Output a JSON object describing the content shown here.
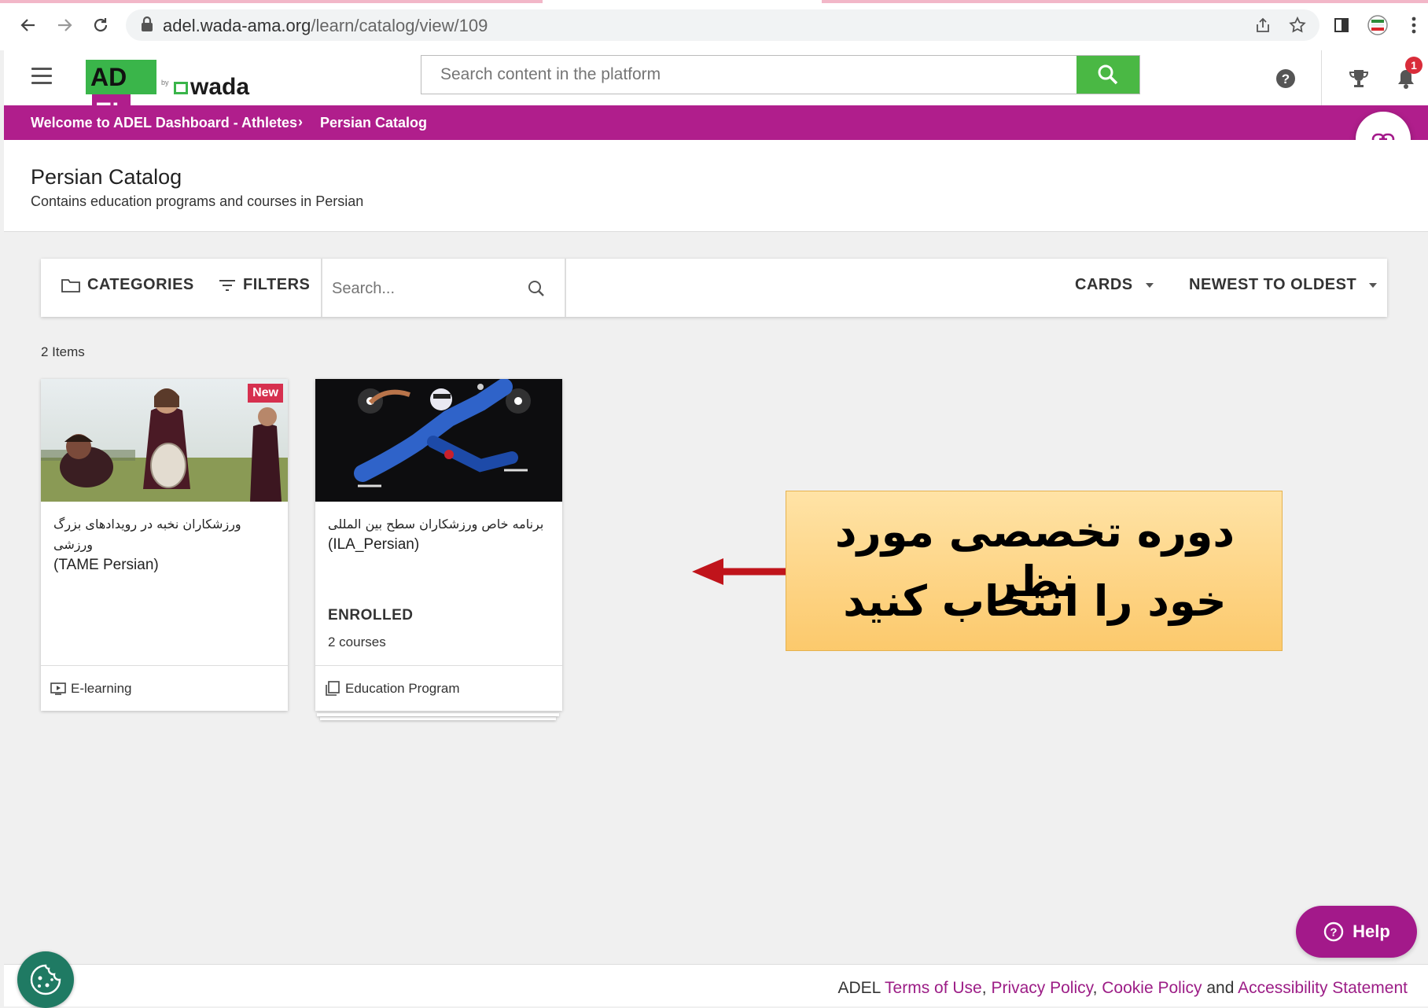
{
  "browser": {
    "url_host": "adel.wada-ama.org",
    "url_path": "/learn/catalog/view/109"
  },
  "header": {
    "logo_adel_left": "AD",
    "logo_adel_right": "EL",
    "logo_by": "by",
    "logo_wada": "wada",
    "search_placeholder": "Search content in the platform",
    "notification_count": "1"
  },
  "breadcrumb": {
    "items": [
      "Welcome to ADEL Dashboard - Athletes",
      "Persian Catalog"
    ],
    "separator": "›"
  },
  "page": {
    "title": "Persian Catalog",
    "subtitle": "Contains education programs and courses in Persian"
  },
  "toolbar": {
    "categories_label": "CATEGORIES",
    "filters_label": "FILTERS",
    "search_placeholder": "Search...",
    "view_label": "CARDS",
    "sort_label": "NEWEST TO OLDEST"
  },
  "items_count": "2 Items",
  "cards": [
    {
      "badge": "New",
      "title_fa": "ورزشکاران نخبه در رویدادهای بزرگ ورزشی",
      "title_en": "(TAME Persian)",
      "type": "E-learning"
    },
    {
      "title_fa": "برنامه خاص ورزشکاران سطح بین المللی",
      "title_en": "(ILA_Persian)",
      "status": "ENROLLED",
      "courses": "2 courses",
      "type": "Education Program"
    }
  ],
  "annotation": {
    "line1": "دوره تخصصی مورد نظر",
    "line2": "خود را انتخاب کنید"
  },
  "help_label": "Help",
  "footer": {
    "brand": "ADEL",
    "terms": "Terms of Use",
    "privacy": "Privacy Policy",
    "cookie": "Cookie Policy",
    "and": "and",
    "accessibility": "Accessibility Statement",
    "comma": ","
  },
  "colors": {
    "brand_magenta": "#b01e8c",
    "brand_green": "#4ab844",
    "annotation_fill": "#fcc96c",
    "arrow_red": "#c0141b"
  }
}
